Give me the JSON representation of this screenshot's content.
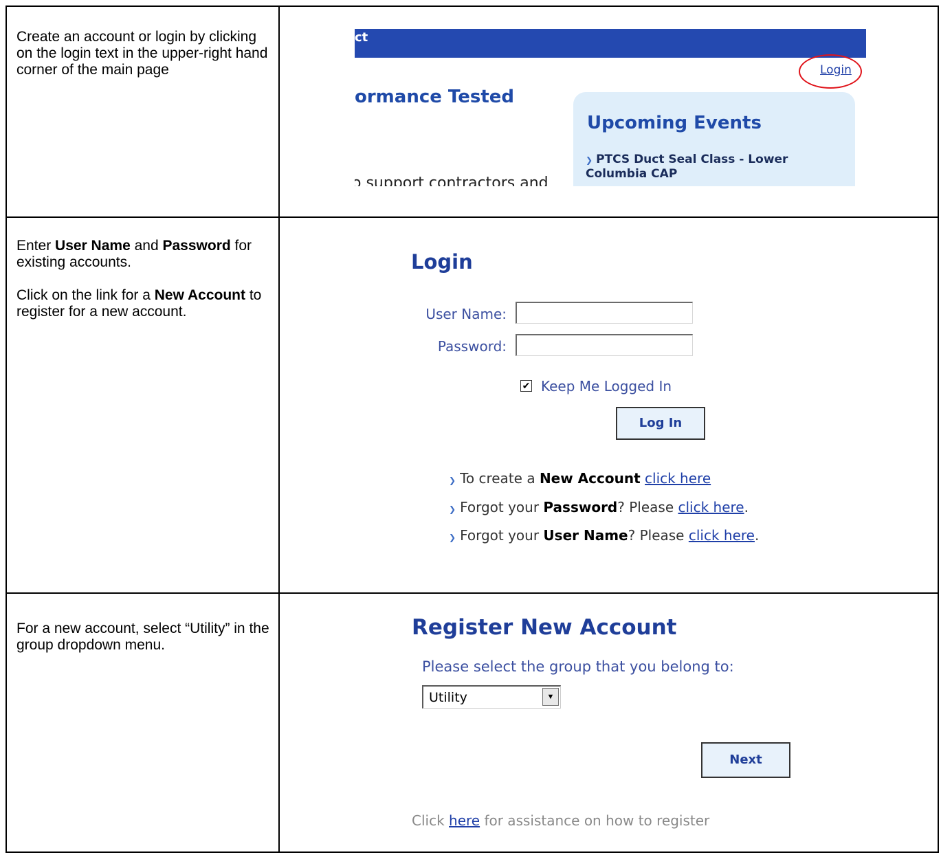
{
  "rows": [
    {
      "instruction": "Create an account or login by clicking on the login text in the upper-right hand corner of the main page",
      "screenshot": {
        "header_fragment": "ct",
        "login_link": "Login",
        "headline": "ormance Tested",
        "body_fragment": "o support contractors and",
        "events_title": "Upcoming Events",
        "event_item": "PTCS Duct Seal Class - Lower Columbia CAP",
        "accent_color": "#e0141b"
      }
    },
    {
      "instruction_parts": {
        "p1_a": "Enter ",
        "p1_b": "User Name",
        "p1_c": " and ",
        "p1_d": "Password",
        "p1_e": " for existing accounts.",
        "p2_a": "Click on the link for a ",
        "p2_b": "New Account",
        "p2_c": " to register for a new account."
      },
      "form": {
        "title": "Login",
        "username_label": "User Name:",
        "username_value": "",
        "password_label": "Password:",
        "password_value": "",
        "keep_logged_in_label": "Keep Me Logged In",
        "keep_logged_in_checked": true,
        "login_button": "Log In",
        "links": [
          {
            "pre": "To create a ",
            "bold": "New Account",
            "mid": " ",
            "link": "click here",
            "post": ""
          },
          {
            "pre": "Forgot your ",
            "bold": "Password",
            "mid": "? Please ",
            "link": "click here",
            "post": "."
          },
          {
            "pre": "Forgot your ",
            "bold": "User Name",
            "mid": "? Please ",
            "link": "click here",
            "post": "."
          }
        ]
      }
    },
    {
      "instruction": "For a new account, select “Utility” in the group dropdown menu.",
      "register": {
        "title": "Register New Account",
        "prompt": "Please select the group that you belong to:",
        "selected_group": "Utility",
        "next_button": "Next",
        "assist_pre": "Click ",
        "assist_link": "here",
        "assist_post": " for assistance on how to register"
      }
    }
  ]
}
